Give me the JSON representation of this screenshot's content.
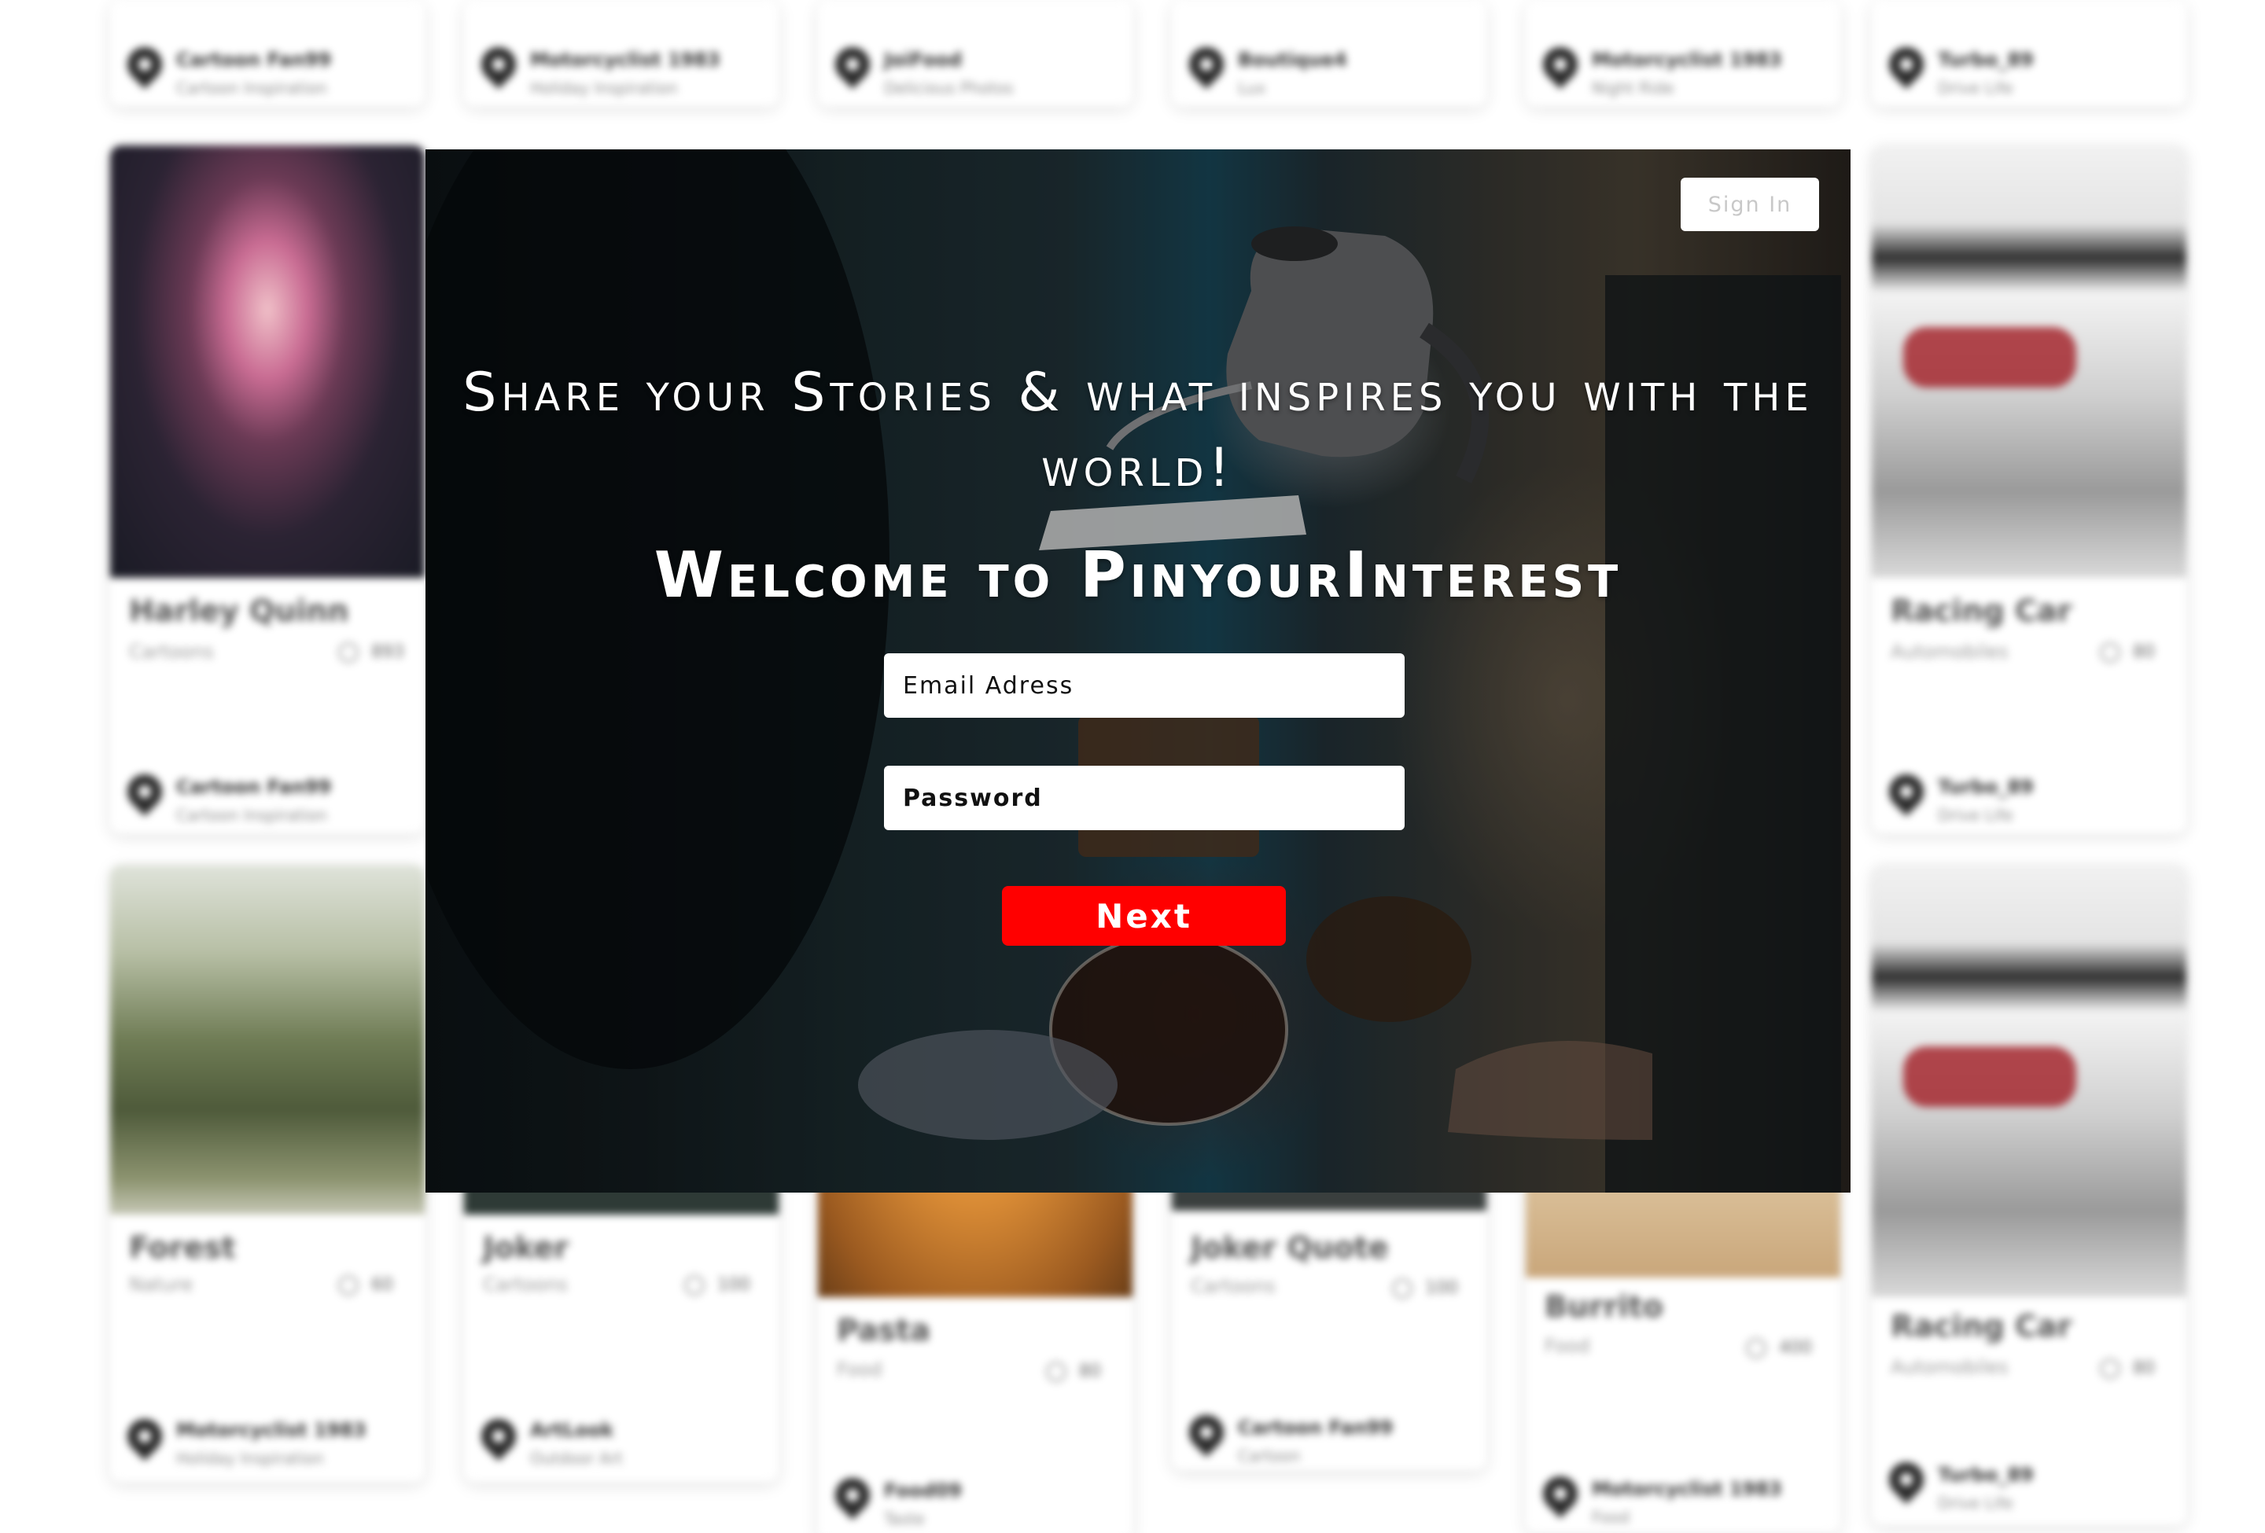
{
  "feed": {
    "cards": [
      {
        "id": "harley-quinn",
        "title": "Harley Quinn",
        "category": "Cartoons",
        "likes": "893"
      },
      {
        "id": "racing-car-1",
        "title": "Racing Car",
        "category": "Automobiles",
        "likes": "80"
      },
      {
        "id": "forest",
        "title": "Forest",
        "category": "Nature",
        "likes": "60"
      },
      {
        "id": "joker",
        "title": "Joker",
        "category": "Cartoons",
        "likes": "100"
      },
      {
        "id": "pasta",
        "title": "Pasta",
        "category": "Food",
        "likes": "80"
      },
      {
        "id": "joker-quote",
        "title": "Joker Quote",
        "category": "Cartoons",
        "likes": "100"
      },
      {
        "id": "burrito",
        "title": "Burrito",
        "category": "Food",
        "likes": "400"
      },
      {
        "id": "racing-car-2",
        "title": "Racing Car",
        "category": "Automobiles",
        "likes": "80"
      }
    ],
    "users": [
      {
        "name": "Cartoon Fan99",
        "sub": "Cartoon Inspiration"
      },
      {
        "name": "Motorcyclist 1983",
        "sub": "Holiday Inspiration"
      },
      {
        "name": "JoiFood",
        "sub": "Delicious Photos"
      },
      {
        "name": "Boutique4",
        "sub": "Lux"
      },
      {
        "name": "Motorcyclist 1983",
        "sub": "Night Ride"
      },
      {
        "name": "Turbo_89",
        "sub": "Drive Life"
      },
      {
        "name": "Cartoon Fan99",
        "sub": "Cartoon Inspiration"
      },
      {
        "name": "Turbo_89",
        "sub": "Drive Life"
      },
      {
        "name": "Motorcyclist 1983",
        "sub": "Holiday Inspiration"
      },
      {
        "name": "ArtLook",
        "sub": "Outdoor Art"
      },
      {
        "name": "Cartoon Fan99",
        "sub": "Cartoon"
      },
      {
        "name": "Turbo_89",
        "sub": "Drive Life"
      },
      {
        "name": "Food09",
        "sub": "Taste"
      },
      {
        "name": "Motorcyclist 1983",
        "sub": "Food"
      }
    ]
  },
  "modal": {
    "sign_in_label": "Sign In",
    "tagline": "Share your Stories & what inspires you with the world!",
    "welcome": "Welcome to PinyourInterest",
    "email_placeholder": "Email Adress",
    "password_placeholder": "Password",
    "next_label": "Next"
  },
  "colors": {
    "accent": "#ff0000",
    "modal_text": "#ffffff",
    "card_bg": "#ffffff"
  }
}
